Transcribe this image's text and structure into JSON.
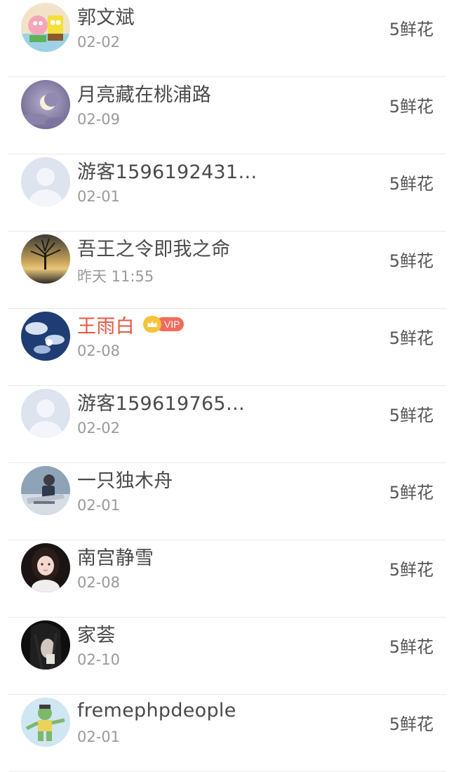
{
  "supporters": [
    {
      "name": "郭文斌",
      "date": "02-02",
      "reward": "5鲜花",
      "avatar_icon": "cartoon-friends-avatar-icon",
      "vip": false
    },
    {
      "name": "月亮藏在桃浦路",
      "date": "02-09",
      "reward": "5鲜花",
      "avatar_icon": "moon-night-avatar-icon",
      "vip": false
    },
    {
      "name": "游客1596192431…",
      "date": "02-01",
      "reward": "5鲜花",
      "avatar_icon": "default-user-avatar-icon",
      "vip": false
    },
    {
      "name": "吾王之令即我之命",
      "date": "昨天 11:55",
      "reward": "5鲜花",
      "avatar_icon": "tree-sunset-avatar-icon",
      "vip": false
    },
    {
      "name": "王雨白",
      "date": "02-08",
      "reward": "5鲜花",
      "avatar_icon": "blue-sky-avatar-icon",
      "vip": true,
      "vip_label": "VIP"
    },
    {
      "name": "游客159619765…",
      "date": "02-02",
      "reward": "5鲜花",
      "avatar_icon": "default-user-avatar-icon",
      "vip": false
    },
    {
      "name": "一只独木舟",
      "date": "02-01",
      "reward": "5鲜花",
      "avatar_icon": "person-photo-avatar-icon",
      "vip": false
    },
    {
      "name": "南宫静雪",
      "date": "02-08",
      "reward": "5鲜花",
      "avatar_icon": "girl-portrait-avatar-icon",
      "vip": false
    },
    {
      "name": "家荟",
      "date": "02-10",
      "reward": "5鲜花",
      "avatar_icon": "dark-hair-avatar-icon",
      "vip": false
    },
    {
      "name": "fremephpdeople",
      "date": "02-01",
      "reward": "5鲜花",
      "avatar_icon": "cartoon-character-avatar-icon",
      "vip": false
    }
  ],
  "colors": {
    "vip_name": "#e8553e",
    "vip_badge": "#f36b5a",
    "crown": "#f5c33b",
    "divider": "#e9e9e9",
    "date_text": "#9a9a9a"
  }
}
